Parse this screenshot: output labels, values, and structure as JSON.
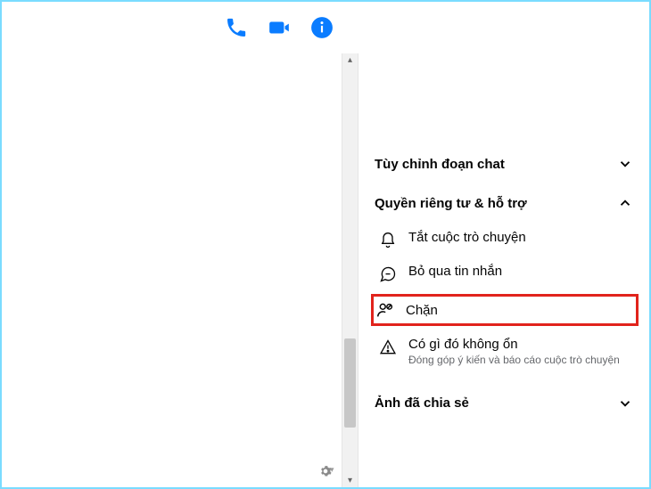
{
  "header": {
    "call_icon": "phone-icon",
    "video_icon": "video-icon",
    "info_icon": "info-icon"
  },
  "sidebar": {
    "customize_label": "Tùy chỉnh đoạn chat",
    "privacy_label": "Quyền riêng tư & hỗ trợ",
    "mute_label": "Tắt cuộc trò chuyện",
    "ignore_label": "Bỏ qua tin nhắn",
    "block_label": "Chặn",
    "wrong_label": "Có gì đó không ổn",
    "wrong_sub": "Đóng góp ý kiến và báo cáo cuộc trò chuyện",
    "shared_label": "Ảnh đã chia sẻ"
  }
}
